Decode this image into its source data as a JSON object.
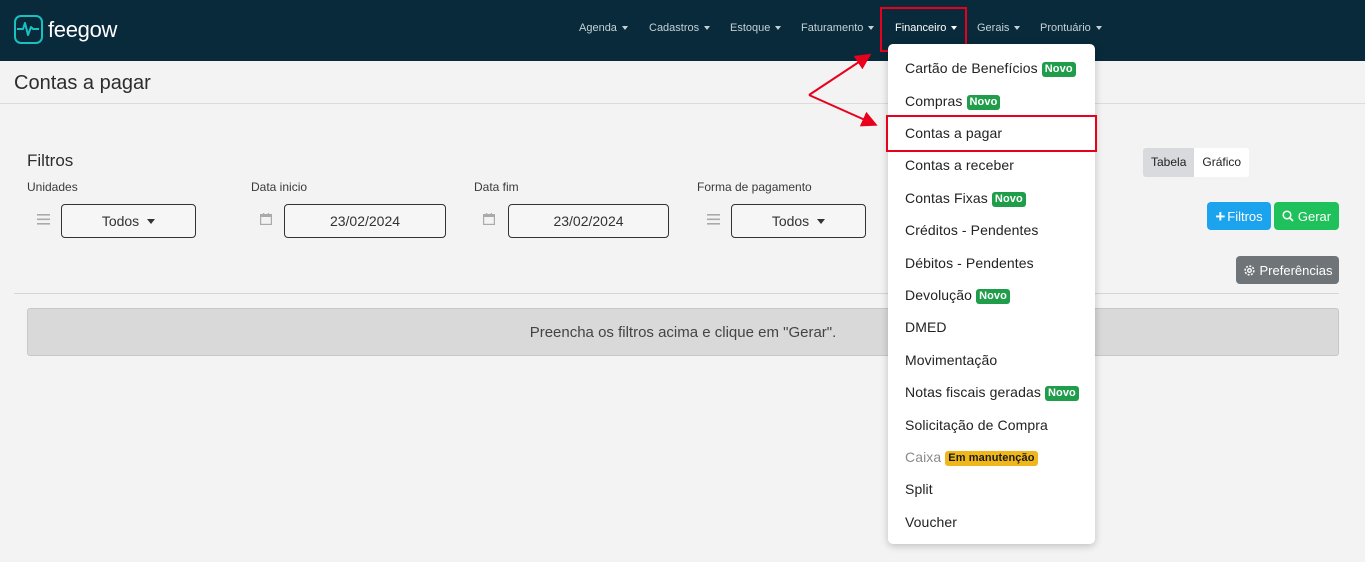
{
  "app": {
    "name": "feegow"
  },
  "nav": {
    "items": [
      {
        "label": "Agenda"
      },
      {
        "label": "Cadastros"
      },
      {
        "label": "Estoque"
      },
      {
        "label": "Faturamento"
      },
      {
        "label": "Financeiro",
        "active": true
      },
      {
        "label": "Gerais"
      },
      {
        "label": "Prontuário"
      }
    ]
  },
  "page": {
    "title": "Contas a pagar"
  },
  "filters": {
    "heading": "Filtros",
    "unidades": {
      "label": "Unidades",
      "value": "Todos"
    },
    "data_inicio": {
      "label": "Data inicio",
      "value": "23/02/2024"
    },
    "data_fim": {
      "label": "Data fim",
      "value": "23/02/2024"
    },
    "forma_pagamento": {
      "label": "Forma de pagamento",
      "value": "Todos"
    }
  },
  "view_toggle": {
    "tabela": "Tabela",
    "grafico": "Gráfico",
    "selected": "Tabela"
  },
  "buttons": {
    "filtros": "Filtros",
    "gerar": "Gerar",
    "preferencias": "Preferências"
  },
  "notice": "Preencha os filtros acima e clique em \"Gerar\".",
  "dropdown": {
    "items": [
      {
        "label": "Cartão de Benefícios",
        "badge": "Novo"
      },
      {
        "label": "Compras",
        "badge": "Novo"
      },
      {
        "label": "Contas a pagar",
        "highlighted": true
      },
      {
        "label": "Contas a receber"
      },
      {
        "label": "Contas Fixas",
        "badge": "Novo"
      },
      {
        "label": "Créditos - Pendentes"
      },
      {
        "label": "Débitos - Pendentes"
      },
      {
        "label": "Devolução",
        "badge": "Novo"
      },
      {
        "label": "DMED"
      },
      {
        "label": "Movimentação"
      },
      {
        "label": "Notas fiscais geradas",
        "badge": "Novo"
      },
      {
        "label": "Solicitação de Compra"
      },
      {
        "label": "Caixa",
        "badge": "Em manutenção",
        "muted": true
      },
      {
        "label": "Split"
      },
      {
        "label": "Voucher"
      }
    ]
  },
  "colors": {
    "topbar": "#082a3a",
    "brand_teal": "#18c1bf",
    "badge_new": "#1f9d4a",
    "badge_warn": "#f0b71b",
    "highlight": "#e8001c",
    "btn_blue": "#1ba3ee",
    "btn_green": "#1fc15a"
  }
}
